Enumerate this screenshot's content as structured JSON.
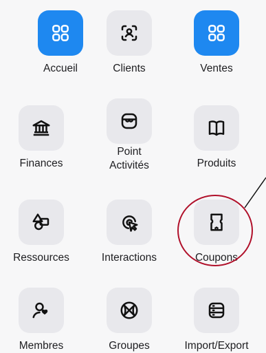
{
  "menu": {
    "items": [
      {
        "label": "Accueil",
        "icon": "grid-icon",
        "active": true
      },
      {
        "label": "Clients",
        "icon": "face-scan-icon",
        "active": false
      },
      {
        "label": "Ventes",
        "icon": "grid-icon",
        "active": true
      },
      {
        "label": "Finances",
        "icon": "bank-icon",
        "active": false
      },
      {
        "label_line1": "Point",
        "label_line2": "Activités",
        "icon": "storefront-icon",
        "active": false
      },
      {
        "label": "Produits",
        "icon": "book-open-icon",
        "active": false
      },
      {
        "label": "Ressources",
        "icon": "shapes-icon",
        "active": false
      },
      {
        "label": "Interactions",
        "icon": "cursor-click-icon",
        "active": false
      },
      {
        "label": "Coupons",
        "icon": "ticket-icon",
        "active": false
      },
      {
        "label": "Membres",
        "icon": "user-heart-icon",
        "active": false
      },
      {
        "label": "Groupes",
        "icon": "basketball-icon",
        "active": false
      },
      {
        "label": "Import/Export",
        "icon": "server-stack-icon",
        "active": false
      }
    ]
  },
  "colors": {
    "accent": "#1e88f0",
    "tile_background": "#e8e8ec",
    "annotation_red": "#b0102a"
  }
}
